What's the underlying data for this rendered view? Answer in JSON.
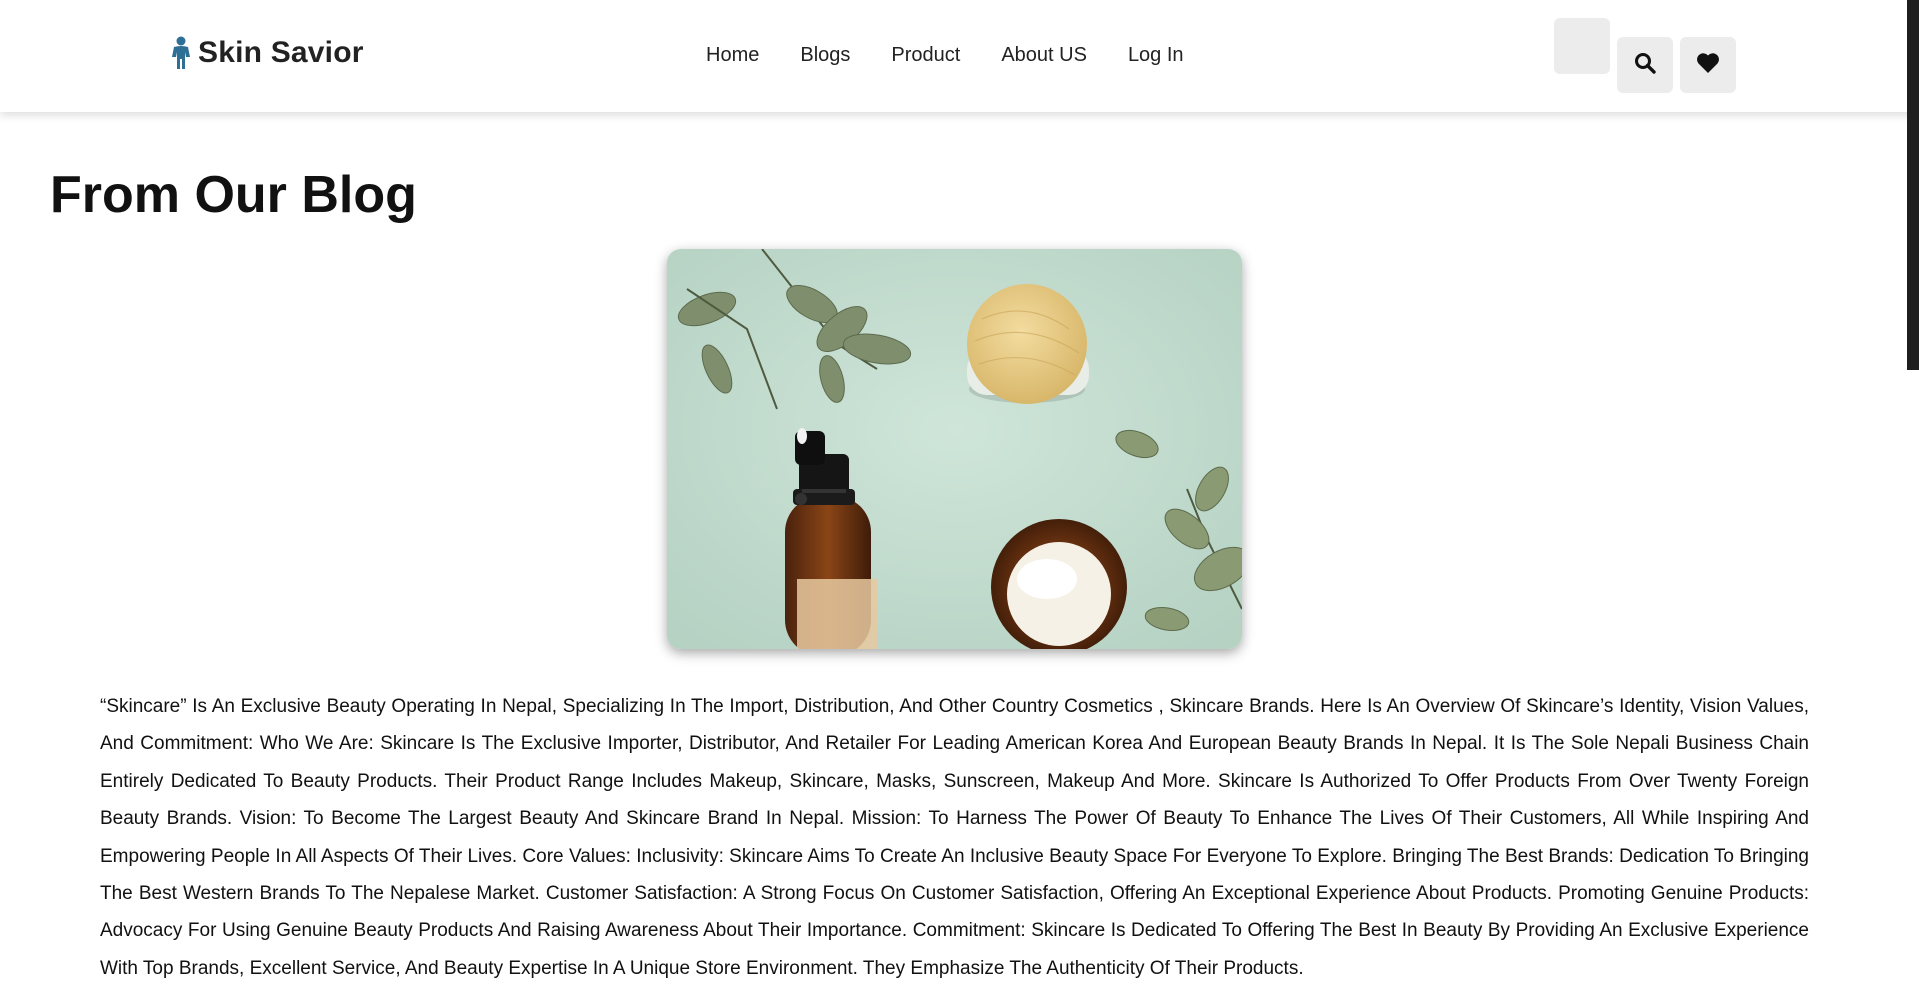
{
  "header": {
    "brand": "Skin Savior",
    "nav": [
      "Home",
      "Blogs",
      "Product",
      "About US",
      "Log In"
    ],
    "icons": {
      "search": "search-icon",
      "wishlist": "heart-icon",
      "logo": "person-icon"
    },
    "brand_color": "#2e6f95"
  },
  "main": {
    "title": "From Our Blog",
    "body": "“Skincare” Is An Exclusive Beauty Operating In Nepal, Specializing In The Import, Distribution, And Other Country Cosmetics , Skincare Brands. Here Is An Overview Of Skincare’s Identity, Vision Values, And Commitment: Who We Are: Skincare Is The Exclusive Importer, Distributor, And Retailer For Leading American Korea And European Beauty Brands In Nepal. It Is The Sole Nepali Business Chain Entirely Dedicated To Beauty Products. Their Product Range Includes Makeup, Skincare, Masks, Sunscreen, Makeup And More. Skincare Is Authorized To Offer Products From Over Twenty Foreign Beauty Brands. Vision: To Become The Largest Beauty And Skincare Brand In Nepal. Mission: To Harness The Power Of Beauty To Enhance The Lives Of Their Customers, All While Inspiring And Empowering People In All Aspects Of Their Lives. Core Values: Inclusivity: Skincare Aims To Create An Inclusive Beauty Space For Everyone To Explore. Bringing The Best Brands: Dedication To Bringing The Best Western Brands To The Nepalese Market. Customer Satisfaction: A Strong Focus On Customer Satisfaction, Offering An Exceptional Experience About Products. Promoting Genuine Products: Advocacy For Using Genuine Beauty Products And Raising Awareness About Their Importance. Commitment: Skincare Is Dedicated To Offering The Best In Beauty By Providing An Exclusive Experience With Top Brands, Excellent Service, And Beauty Expertise In A Unique Store Environment. They Emphasize The Authenticity Of Their Products."
  }
}
